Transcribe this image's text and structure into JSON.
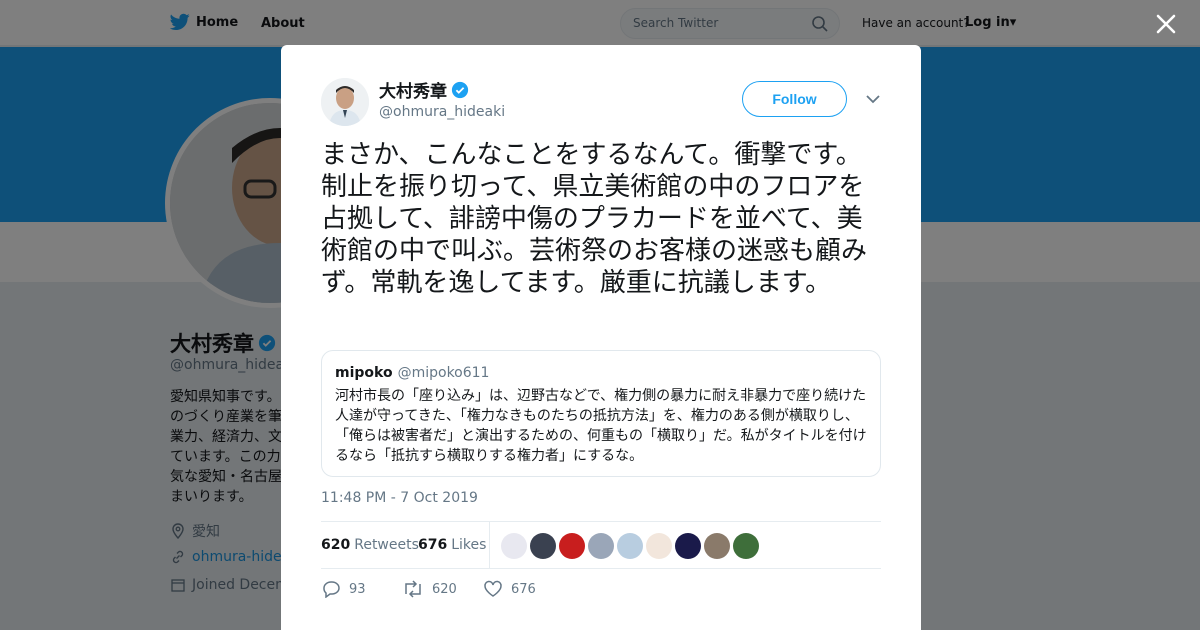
{
  "topbar": {
    "home_label": "Home",
    "about_label": "About",
    "search_placeholder": "Search Twitter",
    "account_text": "Have an account?",
    "login_label": "Log in"
  },
  "profile": {
    "name": "大村秀章",
    "handle": "@ohmura_hideaki",
    "bio": "愛知県知事です。\nのづくり産業を筆\n業力、経済力、文\nています。この力\n気な愛知・名古屋\nまいります。",
    "location": "愛知",
    "website": "ohmura-hidea",
    "joined": "Joined Decem"
  },
  "tweet": {
    "author_name": "大村秀章",
    "author_handle": "@ohmura_hideaki",
    "follow_label": "Follow",
    "text": "まさか、こんなことをするなんて。衝撃です。制止を振り切って、県立美術館の中のフロアを占拠して、誹謗中傷のプラカードを並べて、美術館の中で叫ぶ。芸術祭のお客様の迷惑も顧みず。常軌を逸してます。厳重に抗議します。",
    "quote": {
      "name": "mipoko",
      "handle": "@mipoko611",
      "text": "河村市長の「座り込み」は、辺野古などで、権力側の暴力に耐え非暴力で座り続けた人達が守ってきた、「権力なきものたちの抵抗方法」を、権力のある側が横取りし、「俺らは被害者だ」と演出するための、何重もの「横取り」だ。私がタイトルを付けるなら「抵抗すら横取りする権力者」にするな。"
    },
    "timestamp": "11:48 PM - 7 Oct 2019",
    "retweets_count": "620",
    "retweets_label": "Retweets",
    "likes_count": "676",
    "likes_label": "Likes",
    "actions": {
      "replies": "93",
      "retweets": "620",
      "likes": "676"
    }
  },
  "colors": {
    "accent": "#1da1f2",
    "banner": "#1da1f2",
    "verified": "#1da1f2"
  },
  "likers": [
    "#e8e8f0",
    "#3a4150",
    "#c81e1e",
    "#9aa6b8",
    "#b8cde0",
    "#f2e6dc",
    "#1a1a4a",
    "#8a7a6a",
    "#3e6e3a"
  ]
}
